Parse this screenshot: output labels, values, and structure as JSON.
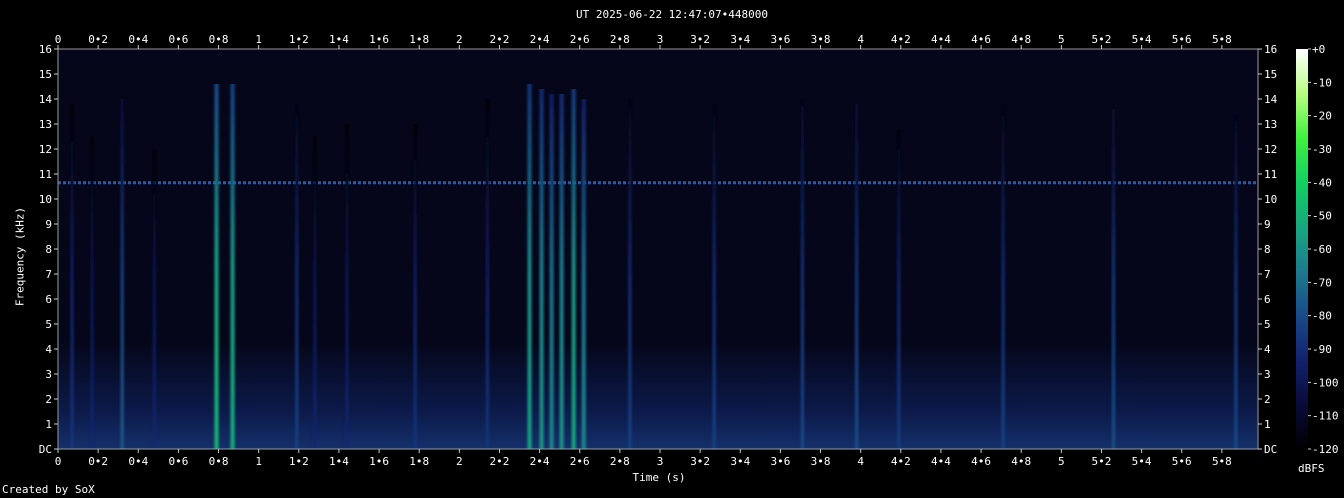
{
  "title": "UT 2025-06-22 12:47:07•448000",
  "credit": "Created by SoX",
  "chart_data": {
    "type": "heatmap",
    "subtype": "spectrogram",
    "xlabel": "Time (s)",
    "ylabel": "Frequency (kHz)",
    "xlim": [
      0,
      5.98
    ],
    "ylim": [
      0,
      16
    ],
    "x_ticks": [
      "0",
      "0•2",
      "0•4",
      "0•6",
      "0•8",
      "1",
      "1•2",
      "1•4",
      "1•6",
      "1•8",
      "2",
      "2•2",
      "2•4",
      "2•6",
      "2•8",
      "3",
      "3•2",
      "3•4",
      "3•6",
      "3•8",
      "4",
      "4•2",
      "4•4",
      "4•6",
      "4•8",
      "5",
      "5•2",
      "5•4",
      "5•6",
      "5•8"
    ],
    "x_tick_values": [
      0,
      0.2,
      0.4,
      0.6,
      0.8,
      1.0,
      1.2,
      1.4,
      1.6,
      1.8,
      2.0,
      2.2,
      2.4,
      2.6,
      2.8,
      3.0,
      3.2,
      3.4,
      3.6,
      3.8,
      4.0,
      4.2,
      4.4,
      4.6,
      4.8,
      5.0,
      5.2,
      5.4,
      5.6,
      5.8
    ],
    "y_ticks": [
      "DC",
      "1",
      "2",
      "3",
      "4",
      "5",
      "6",
      "7",
      "8",
      "9",
      "10",
      "11",
      "12",
      "13",
      "14",
      "15",
      "16"
    ],
    "y_tick_values": [
      0,
      1,
      2,
      3,
      4,
      5,
      6,
      7,
      8,
      9,
      10,
      11,
      12,
      13,
      14,
      15,
      16
    ],
    "colorbar": {
      "label": "dBFS",
      "ticks": [
        "+0",
        "-10",
        "-20",
        "-30",
        "-40",
        "-50",
        "-60",
        "-70",
        "-80",
        "-90",
        "-100",
        "-110",
        "-120"
      ],
      "range": [
        -120,
        0
      ],
      "colors": [
        "#000000",
        "#0a0a3a",
        "#12226e",
        "#1a4a8a",
        "#1d7a8e",
        "#18a880",
        "#12d060",
        "#40f040",
        "#b8ff80",
        "#ffffff"
      ]
    },
    "tonal_line_khz": 10.65,
    "events": [
      {
        "t": 0.07,
        "top_khz": 13.8,
        "level_db": -95
      },
      {
        "t": 0.17,
        "top_khz": 12.5,
        "level_db": -100
      },
      {
        "t": 0.32,
        "top_khz": 14.0,
        "level_db": -82
      },
      {
        "t": 0.48,
        "top_khz": 12.0,
        "level_db": -100
      },
      {
        "t": 0.79,
        "top_khz": 14.6,
        "level_db": -55
      },
      {
        "t": 0.87,
        "top_khz": 14.6,
        "level_db": -58
      },
      {
        "t": 1.19,
        "top_khz": 13.8,
        "level_db": -90
      },
      {
        "t": 1.28,
        "top_khz": 12.5,
        "level_db": -100
      },
      {
        "t": 1.44,
        "top_khz": 13.0,
        "level_db": -100
      },
      {
        "t": 1.78,
        "top_khz": 13.0,
        "level_db": -95
      },
      {
        "t": 2.14,
        "top_khz": 14.0,
        "level_db": -95
      },
      {
        "t": 2.35,
        "top_khz": 14.6,
        "level_db": -62
      },
      {
        "t": 2.41,
        "top_khz": 14.4,
        "level_db": -66
      },
      {
        "t": 2.46,
        "top_khz": 14.2,
        "level_db": -70
      },
      {
        "t": 2.51,
        "top_khz": 14.2,
        "level_db": -66
      },
      {
        "t": 2.57,
        "top_khz": 14.4,
        "level_db": -60
      },
      {
        "t": 2.62,
        "top_khz": 14.0,
        "level_db": -70
      },
      {
        "t": 2.85,
        "top_khz": 14.0,
        "level_db": -90
      },
      {
        "t": 3.27,
        "top_khz": 13.8,
        "level_db": -90
      },
      {
        "t": 3.71,
        "top_khz": 14.0,
        "level_db": -88
      },
      {
        "t": 3.98,
        "top_khz": 13.8,
        "level_db": -86
      },
      {
        "t": 4.19,
        "top_khz": 12.8,
        "level_db": -92
      },
      {
        "t": 4.71,
        "top_khz": 13.8,
        "level_db": -90
      },
      {
        "t": 5.26,
        "top_khz": 13.6,
        "level_db": -86
      },
      {
        "t": 5.87,
        "top_khz": 13.4,
        "level_db": -88
      }
    ]
  }
}
